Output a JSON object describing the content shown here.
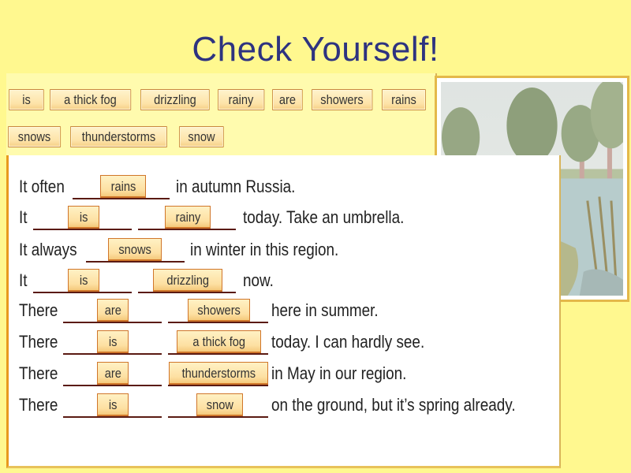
{
  "title": "Check Yourself!",
  "word_bank": [
    "is",
    "a thick fog",
    "drizzling",
    "rainy",
    "are",
    "showers",
    "rains",
    "snows",
    "thunderstorms",
    "snow"
  ],
  "sentences": [
    {
      "start": "It often",
      "answers": [
        "rains"
      ],
      "end": "in autumn Russia."
    },
    {
      "start": "It",
      "answers": [
        "is",
        "rainy"
      ],
      "end": "today. Take an umbrella."
    },
    {
      "start": "It always",
      "answers": [
        "snows"
      ],
      "end": "in winter in this region."
    },
    {
      "start": "It",
      "answers": [
        "is",
        "drizzling"
      ],
      "end": "now."
    },
    {
      "start": "There",
      "answers": [
        "are",
        "showers"
      ],
      "end": "here in summer."
    },
    {
      "start": "There",
      "answers": [
        "is",
        "a thick fog"
      ],
      "end": "today. I can hardly see."
    },
    {
      "start": "There",
      "answers": [
        "are",
        "thunderstorms"
      ],
      "end": "in May in our region."
    },
    {
      "start": "There",
      "answers": [
        "is",
        "snow"
      ],
      "end": "on the ground, but it’s spring already."
    }
  ],
  "picture": {
    "description": "landscape-illustration",
    "subject": "trees beside a river with reeds"
  },
  "colors": {
    "background": "#fff88f",
    "title": "#2e3380",
    "chip_border": "#c9893e",
    "answer_border": "#d0762a",
    "panel_border": "#e89a1e"
  }
}
